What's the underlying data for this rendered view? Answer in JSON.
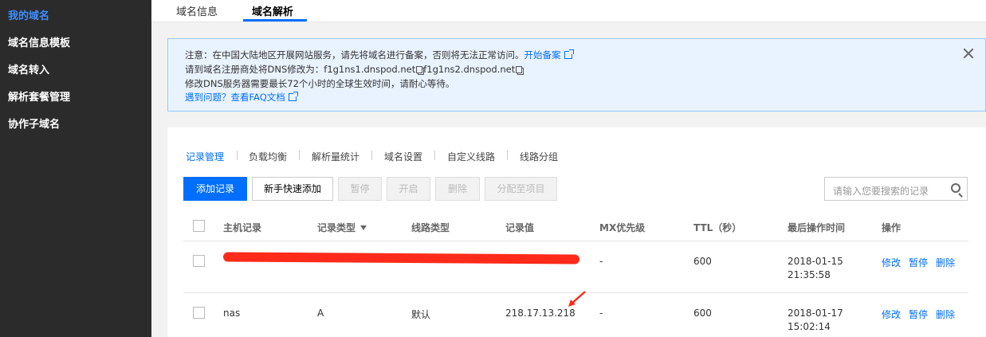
{
  "sidebar": {
    "items": [
      {
        "label": "我的域名",
        "active": true
      },
      {
        "label": "域名信息模板"
      },
      {
        "label": "域名转入"
      },
      {
        "label": "解析套餐管理"
      },
      {
        "label": "协作子域名"
      }
    ]
  },
  "top_tabs": [
    {
      "label": "域名信息"
    },
    {
      "label": "域名解析",
      "active": true
    }
  ],
  "notice": {
    "line1_text": "注意：在中国大陆地区开展网站服务，请先将域名进行备案，否则将无法正常访问。",
    "line1_link": "开始备案",
    "line2_text": "请到域名注册商处将DNS修改为：",
    "dns1": "f1g1ns1.dnspod.net",
    "dns2": "f1g1ns2.dnspod.net",
    "line3_text": "修改DNS服务器需要最长72个小时的全球生效时间，请耐心等待。",
    "line4_link": "遇到问题？查看FAQ文档"
  },
  "sub_tabs": [
    {
      "label": "记录管理",
      "active": true
    },
    {
      "label": "负载均衡"
    },
    {
      "label": "解析量统计"
    },
    {
      "label": "域名设置"
    },
    {
      "label": "自定义线路"
    },
    {
      "label": "线路分组"
    }
  ],
  "toolbar": {
    "add_label": "添加记录",
    "quick_add_label": "新手快速添加",
    "pause_label": "暂停",
    "enable_label": "开启",
    "delete_label": "删除",
    "assign_label": "分配至项目"
  },
  "search": {
    "placeholder": "请输入您要搜索的记录"
  },
  "table": {
    "headers": [
      "主机记录",
      "记录类型",
      "线路类型",
      "记录值",
      "MX优先级",
      "TTL（秒）",
      "最后操作时间",
      "操作"
    ],
    "rows": [
      {
        "host": "",
        "type": "",
        "line": "",
        "value": "",
        "mx": "-",
        "ttl": "600",
        "date": "2018-01-15",
        "time": "21:35:58",
        "op_edit": "修改",
        "op_pause": "暂停",
        "op_delete": "删除"
      },
      {
        "host": "nas",
        "type": "A",
        "line": "默认",
        "value": "218.17.13.218",
        "mx": "-",
        "ttl": "600",
        "date": "2018-01-17",
        "time": "15:02:14",
        "op_edit": "修改",
        "op_pause": "暂停",
        "op_delete": "删除"
      }
    ]
  },
  "colors": {
    "accent": "#006eff",
    "sidebar_bg": "#2b2b2b",
    "annotation": "#ff2a1a"
  }
}
